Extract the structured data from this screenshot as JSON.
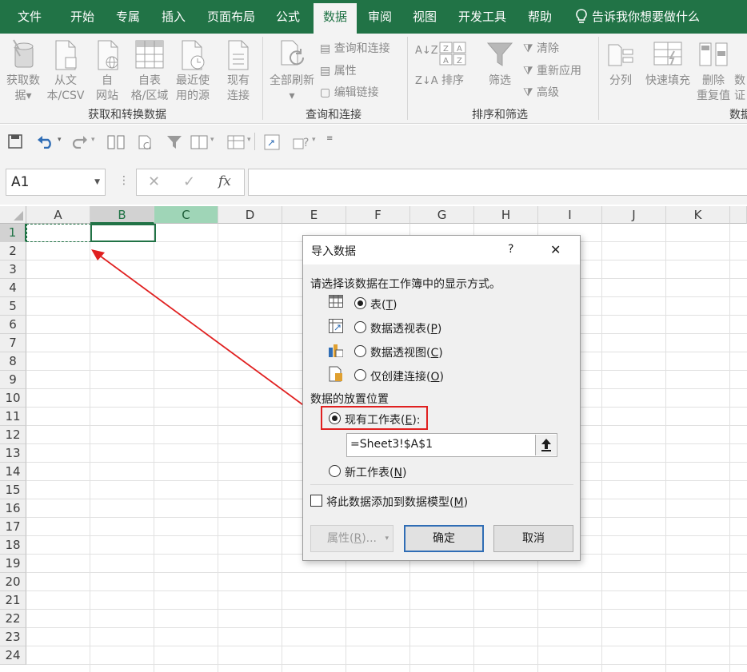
{
  "tabs": {
    "file": "文件",
    "home": "开始",
    "exclusive": "专属",
    "insert": "插入",
    "page_layout": "页面布局",
    "formulas": "公式",
    "data": "数据",
    "review": "审阅",
    "view": "视图",
    "developer": "开发工具",
    "help": "帮助",
    "tell_me": "告诉我你想要做什么"
  },
  "ribbon": {
    "get_data": [
      "获取数",
      "据"
    ],
    "from_csv": [
      "从文",
      "本/CSV"
    ],
    "from_web": [
      "自",
      "网站"
    ],
    "from_table": [
      "自表",
      "格/区域"
    ],
    "recent_sources": [
      "最近使",
      "用的源"
    ],
    "existing_connections": [
      "现有",
      "连接"
    ],
    "refresh_all": "全部刷新",
    "queries_connections": "查询和连接",
    "properties": "属性",
    "edit_links": "编辑链接",
    "sort_az": "A↓Z",
    "sort_za": "Z↓A",
    "sort": "排序",
    "filter": "筛选",
    "clear": "清除",
    "reapply": "重新应用",
    "advanced": "高级",
    "text_to_columns": "分列",
    "flash_fill": "快速填充",
    "remove_duplicates": [
      "删除",
      "重复值"
    ],
    "data_tools_partial": [
      "数",
      "证"
    ],
    "groups": {
      "get_transform": "获取和转换数据",
      "queries": "查询和连接",
      "sort_filter": "排序和筛选",
      "data_tools": "数据"
    }
  },
  "formula_bar": {
    "name_box": "A1",
    "fx": "fx",
    "formula": ""
  },
  "grid": {
    "columns": [
      "A",
      "B",
      "C",
      "D",
      "E",
      "F",
      "G",
      "H",
      "I",
      "J",
      "K"
    ],
    "rows": [
      "1",
      "2",
      "3",
      "4",
      "5",
      "6",
      "7",
      "8",
      "9",
      "10",
      "11",
      "12",
      "13",
      "14",
      "15",
      "16",
      "17",
      "18",
      "19",
      "20",
      "21",
      "22",
      "23",
      "24"
    ]
  },
  "dialog": {
    "title": "导入数据",
    "help": "?",
    "close": "✕",
    "prompt": "请选择该数据在工作簿中的显示方式。",
    "view_options": [
      {
        "label": "表(",
        "key": "T",
        "suffix": ")",
        "selected": true
      },
      {
        "label": "数据透视表(",
        "key": "P",
        "suffix": ")",
        "selected": false
      },
      {
        "label": "数据透视图(",
        "key": "C",
        "suffix": ")",
        "selected": false
      },
      {
        "label": "仅创建连接(",
        "key": "O",
        "suffix": ")",
        "selected": false
      }
    ],
    "placement_heading": "数据的放置位置",
    "existing_sheet": {
      "label": "现有工作表(",
      "key": "E",
      "suffix": "):"
    },
    "range_value": "=Sheet3!$A$1",
    "new_sheet": {
      "label": "新工作表(",
      "key": "N",
      "suffix": ")"
    },
    "add_to_model": {
      "label": "将此数据添加到数据模型(",
      "key": "M",
      "suffix": ")"
    },
    "properties_btn": {
      "label": "属性(",
      "key": "R",
      "suffix": ")..."
    },
    "ok": "确定",
    "cancel": "取消"
  },
  "colors": {
    "excel_green": "#217346",
    "annotation_red": "#e02020",
    "accent_blue": "#2f6db5"
  }
}
